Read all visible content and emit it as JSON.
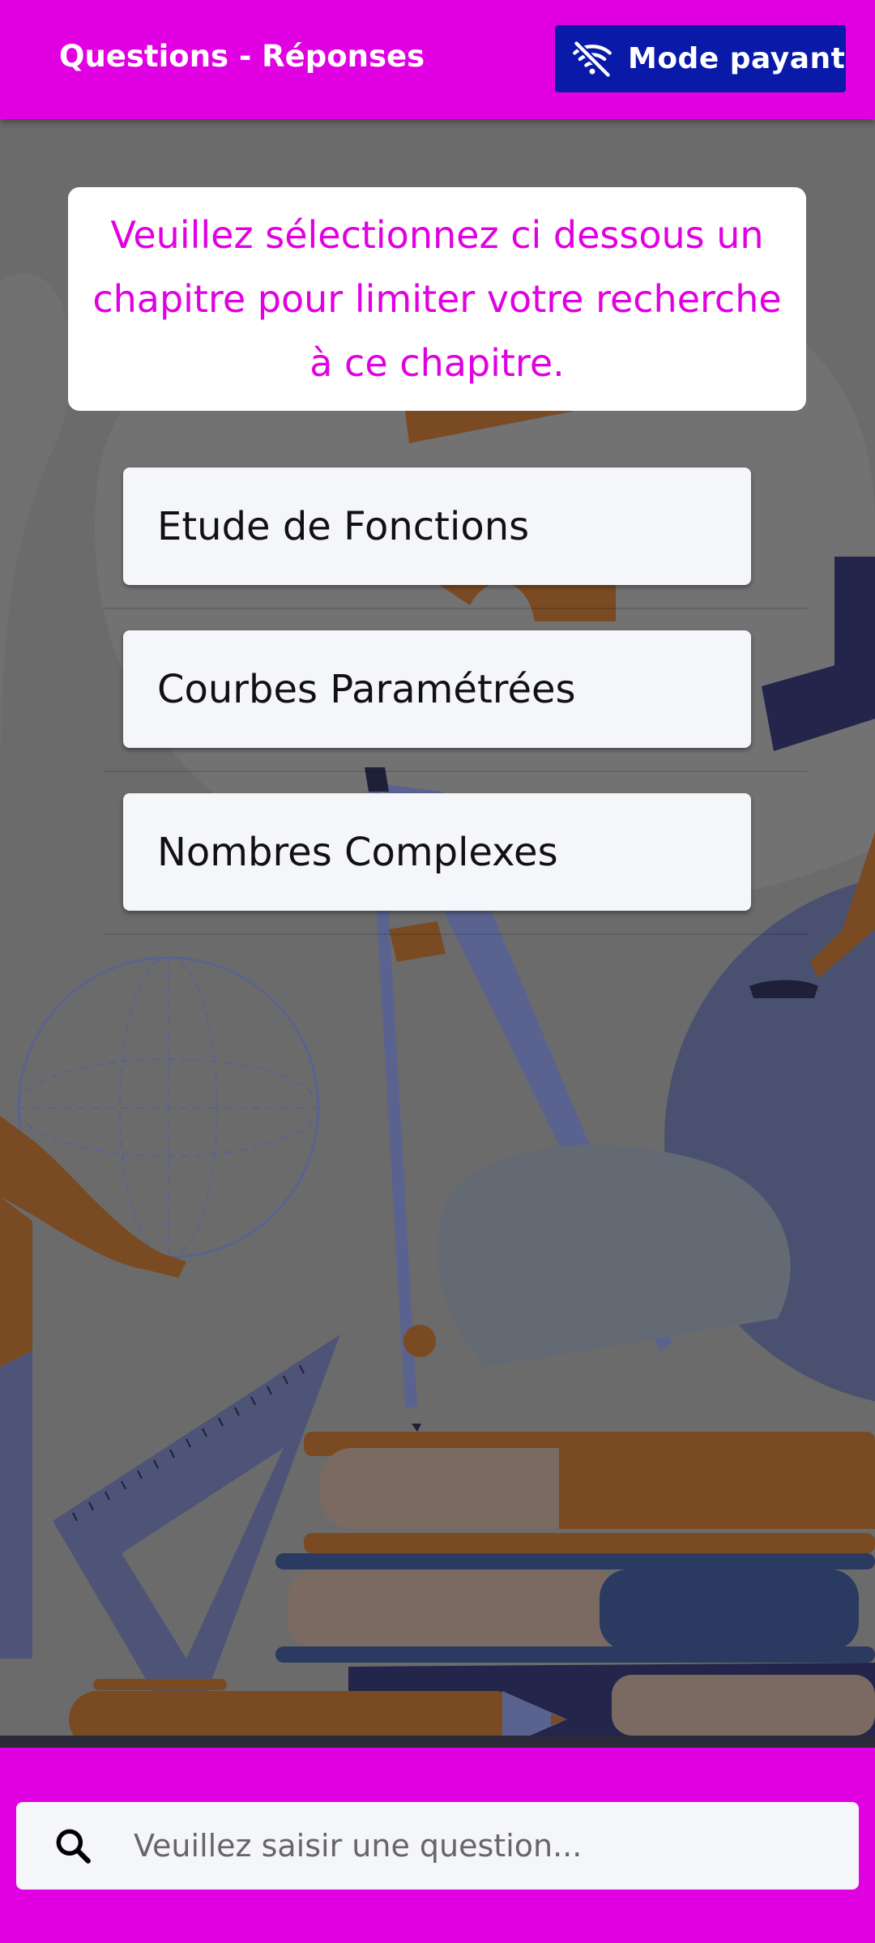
{
  "header": {
    "title": "Questions - Réponses",
    "mode_button_label": "Mode payant",
    "mode_button_icon": "wifi-off-icon"
  },
  "notice": {
    "text": "Veuillez sélectionnez ci dessous un chapitre pour limiter votre recherche à ce chapitre."
  },
  "chapters": [
    {
      "label": "Etude de Fonctions"
    },
    {
      "label": "Courbes Paramétrées"
    },
    {
      "label": "Nombres Complexes"
    }
  ],
  "search": {
    "icon": "search-icon",
    "placeholder": "Veuillez saisir une question..."
  },
  "colors": {
    "brand": "#e100e1",
    "mode_button": "#0a1aa8",
    "card": "#f5f6fa"
  }
}
